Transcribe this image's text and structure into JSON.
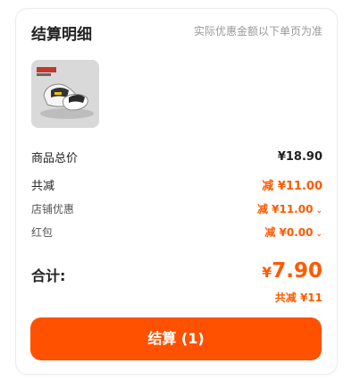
{
  "header": {
    "title": "结算明细",
    "note": "实际优惠金额以下单页为准"
  },
  "product": {
    "thumb_icon": "slipper-product-image"
  },
  "summary": {
    "goods_total_label": "商品总价",
    "goods_total_value": "¥18.90",
    "reduce_label": "共减",
    "reduce_value": "减 ¥11.00",
    "shop_discount_label": "店铺优惠",
    "shop_discount_value": "减 ¥11.00",
    "red_packet_label": "红包",
    "red_packet_value": "减 ¥0.00"
  },
  "total": {
    "label": "合计:",
    "currency": "¥",
    "amount": "7.90",
    "saved": "共减 ¥11"
  },
  "checkout": {
    "label": "结算 (1)"
  },
  "colors": {
    "accent": "#ff5100",
    "muted": "#999999"
  }
}
